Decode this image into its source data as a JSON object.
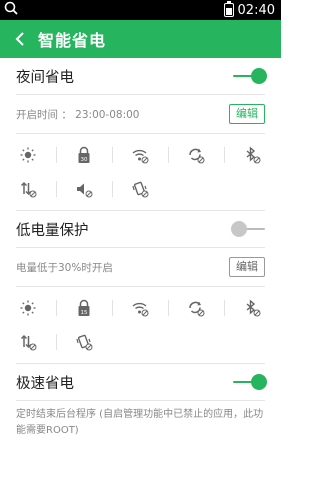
{
  "status": {
    "time": "02:40"
  },
  "titlebar": {
    "title": "智能省电"
  },
  "night": {
    "label": "夜间省电",
    "enabled": true,
    "time_text": "开启时间 ： 23:00-08:00",
    "edit_label": "编辑",
    "icons_row1": [
      "brightness-icon",
      "timeout-30-icon",
      "wifi-off-icon",
      "sync-off-icon",
      "bluetooth-off-icon"
    ],
    "icons_row2": [
      "data-off-icon",
      "sound-off-icon",
      "vibrate-off-icon"
    ]
  },
  "low_battery": {
    "label": "低电量保护",
    "enabled": false,
    "condition_text": "电量低于30%时开启",
    "edit_label": "编辑",
    "icons_row1": [
      "brightness-icon",
      "timeout-15-icon",
      "wifi-off-icon",
      "sync-off-icon",
      "bluetooth-off-icon"
    ],
    "icons_row2": [
      "data-off-icon",
      "vibrate-off-icon"
    ]
  },
  "speed": {
    "label": "极速省电",
    "enabled": true,
    "description": "定时结束后台程序 (自启管理功能中已禁止的应用，此功能需要ROOT)"
  },
  "colors": {
    "accent": "#27b45f",
    "toggle_off": "#c7c7c7"
  }
}
